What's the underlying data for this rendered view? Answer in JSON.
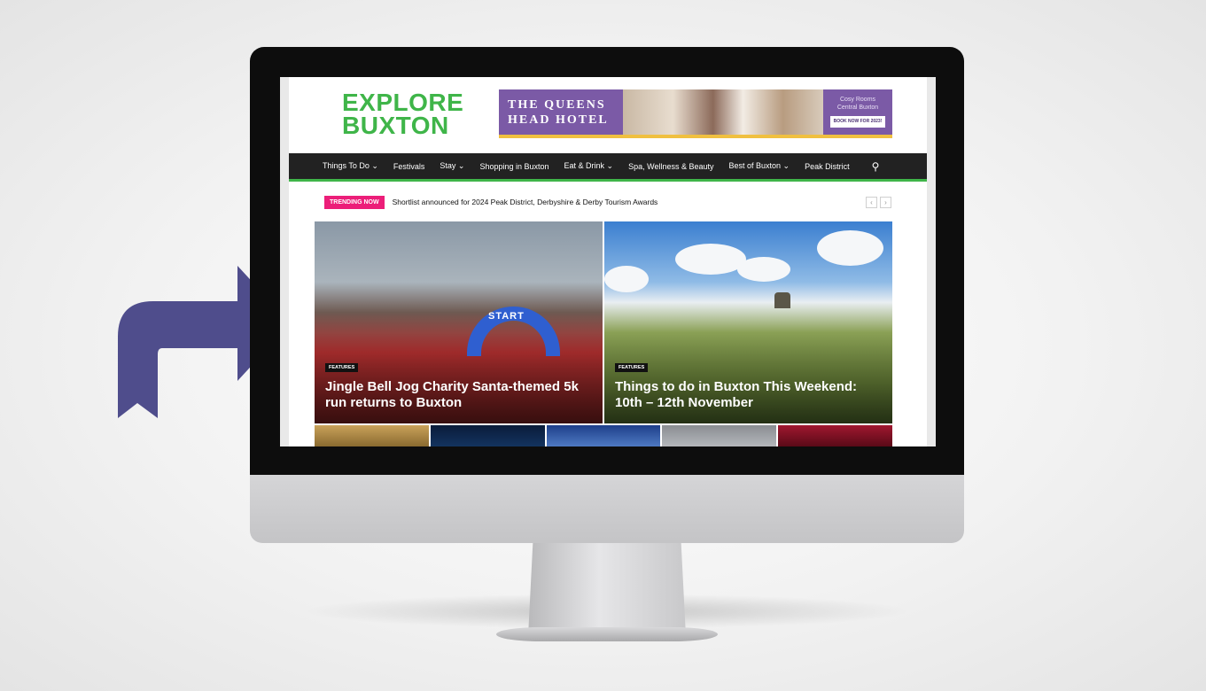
{
  "site": {
    "logo_line1": "EXPLORE",
    "logo_line2": "BUXTON"
  },
  "ad": {
    "title": "THE QUEENS HEAD HOTEL",
    "tagline_1": "Cosy Rooms",
    "tagline_2": "Central Buxton",
    "cta": "BOOK NOW FOR 2023!"
  },
  "nav": {
    "items": [
      "Things To Do ⌄",
      "Festivals",
      "Stay ⌄",
      "Shopping in Buxton",
      "Eat & Drink ⌄",
      "Spa, Wellness & Beauty",
      "Best of Buxton ⌄",
      "Peak District"
    ]
  },
  "trending": {
    "badge": "TRENDING NOW",
    "headline": "Shortlist announced for 2024 Peak District, Derbyshire & Derby Tourism Awards"
  },
  "featured": [
    {
      "category": "FEATURES",
      "title": "Jingle Bell Jog Charity Santa-themed 5k run returns to Buxton",
      "arch_text": "START"
    },
    {
      "category": "FEATURES",
      "title": "Things to do in Buxton This Weekend: 10th – 12th November"
    }
  ],
  "colors": {
    "brand_green": "#3fb549",
    "trending_pink": "#ec1e79",
    "nav_bg": "#222222",
    "ad_purple": "#7b5aa6",
    "arrow": "#4f4d8c"
  }
}
